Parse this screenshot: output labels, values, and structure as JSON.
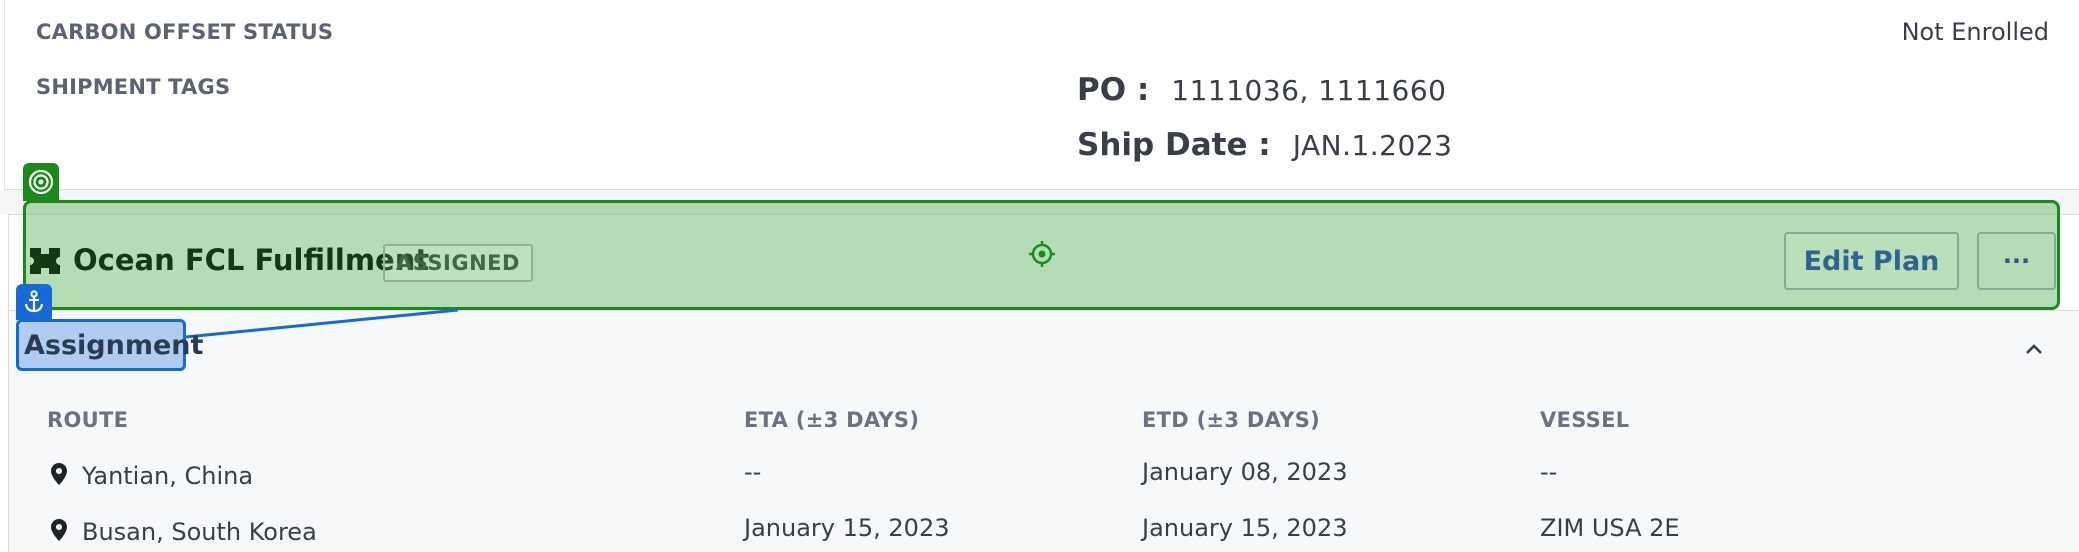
{
  "shipment": {
    "carbon_offset_label": "CARBON OFFSET STATUS",
    "carbon_offset_value": "Not Enrolled",
    "tags_label": "SHIPMENT TAGS",
    "po_label": "PO :",
    "po_value": "1111036, 1111660",
    "ship_date_label": "Ship Date :",
    "ship_date_value": "JAN.1.2023"
  },
  "fulfillment": {
    "title": "Ocean FCL Fulfillment",
    "status_badge": "ASSIGNED",
    "edit_button": "Edit Plan",
    "more_button": "···"
  },
  "assignment": {
    "heading": "Assignment",
    "columns": [
      "ROUTE",
      "ETA (±3 DAYS)",
      "ETD (±3 DAYS)",
      "VESSEL"
    ],
    "rows": [
      {
        "route": "Yantian, China",
        "eta": "--",
        "etd": "January 08, 2023",
        "vessel": "--"
      },
      {
        "route": "Busan, South Korea",
        "eta": "January 15, 2023",
        "etd": "January 15, 2023",
        "vessel": "ZIM USA 2E"
      }
    ]
  },
  "icons": {
    "target": "target-icon",
    "anchor": "anchor-icon",
    "locate": "crosshair-icon",
    "ticket": "ticket-icon",
    "pin": "map-pin-icon",
    "caret": "chevron-up-icon"
  },
  "colors": {
    "highlight_green": "#1b8a1b",
    "highlight_blue": "#1769d6",
    "link_blue": "#2f6491"
  }
}
